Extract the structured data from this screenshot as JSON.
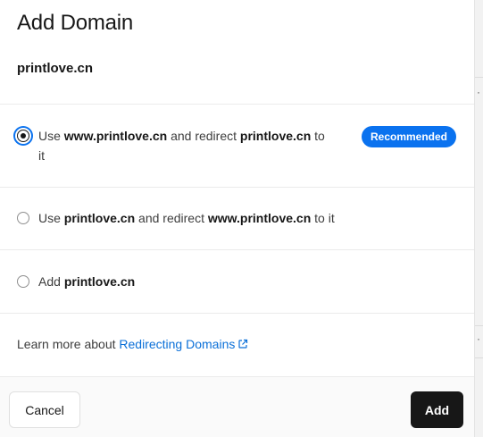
{
  "modal": {
    "title": "Add Domain",
    "domain": "printlove.cn"
  },
  "options": [
    {
      "selected": true,
      "prefix": "Use ",
      "primary": "www.printlove.cn",
      "middle": " and redirect ",
      "secondary": "printlove.cn",
      "suffix_line1": " to",
      "suffix_line2": "it",
      "badge": "Recommended"
    },
    {
      "selected": false,
      "prefix": "Use ",
      "primary": "printlove.cn",
      "middle": " and redirect ",
      "secondary": "www.printlove.cn",
      "suffix": " to it"
    },
    {
      "selected": false,
      "prefix": "Add ",
      "primary": "printlove.cn"
    }
  ],
  "learn_more": {
    "text": "Learn more about ",
    "link": "Redirecting Domains",
    "icon": "external-link-icon"
  },
  "footer": {
    "cancel_label": "Cancel",
    "add_label": "Add"
  },
  "colors": {
    "accent": "#0a72ef",
    "link": "#0a6fd8",
    "primary_button": "#171717"
  }
}
